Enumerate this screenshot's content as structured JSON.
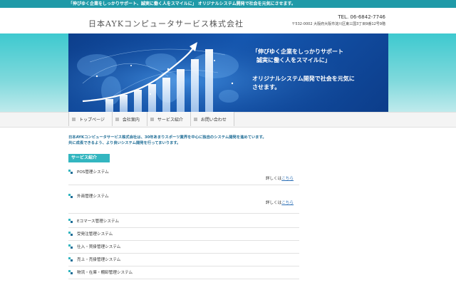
{
  "topbar": {
    "text": "「伸びゆく企業をしっかりサポート、誠実に働く人をスマイルに」 オリジナルシステム開発で社会を元気にさせます。"
  },
  "header": {
    "logo": "日本AYKコンピュータサービス株式会社",
    "tel": "TEL. 06-6842-7746",
    "address": "〒532-0002 大阪府大阪市淀川区東三国3丁目9番12号9階"
  },
  "hero": {
    "line1": "「伸びゆく企業をしっかりサポート",
    "line2": "誠実に働く人をスマイルに」",
    "line3": "オリジナルシステム開発で社会を元気に",
    "line4": "させます。"
  },
  "nav": [
    {
      "label": "トップページ"
    },
    {
      "label": "会社案内"
    },
    {
      "label": "サービス紹介"
    },
    {
      "label": "お問い合わせ"
    }
  ],
  "intro": {
    "line1": "日本AYKコンピュータサービス株式会社は、30年あまりスポーツ業界を中心に独自のシステム開発を進めています。",
    "line2": "共に成長できるよう、より良いシステム開発を行ってまいります。"
  },
  "services": {
    "label": "サービス紹介",
    "detail_prefix": "詳しくは",
    "detail_link": "こちら",
    "items": [
      {
        "name": "POS管理システム"
      },
      {
        "name": "外商管理システム"
      },
      {
        "name": "Eコマース管理システム"
      },
      {
        "name": "受発注管理システム"
      },
      {
        "name": "仕入・買掛管理システム"
      },
      {
        "name": "売上・売掛管理システム"
      },
      {
        "name": "物流・在庫・棚卸管理システム"
      }
    ]
  },
  "colors": {
    "accent": "#1f9aa8",
    "teal_band": "#3ec9cf",
    "hero_blue": "#1557b0",
    "link": "#2b6fb6"
  }
}
